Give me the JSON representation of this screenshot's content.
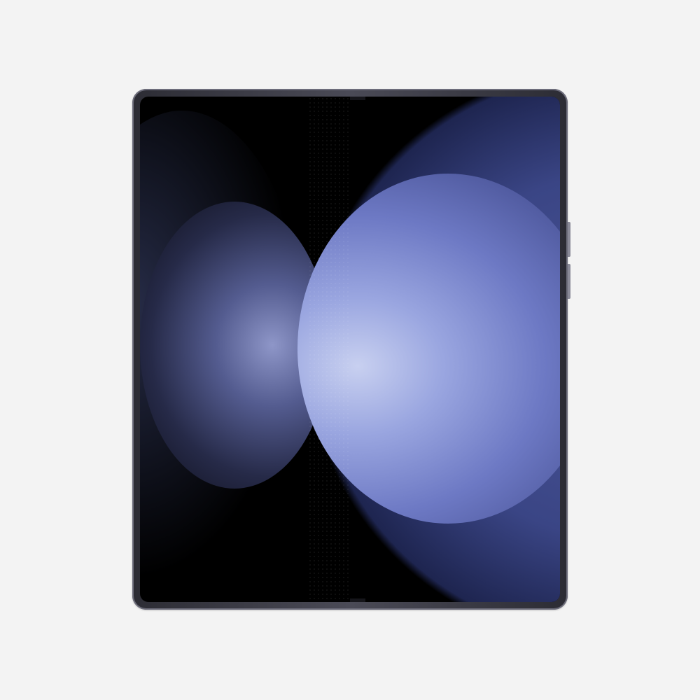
{
  "image": {
    "subject": "foldable-phone",
    "colors": {
      "background": "#f3f3f3",
      "frame": "#3a3a44",
      "screen": "#000000",
      "accent": "#7b86cf"
    }
  }
}
